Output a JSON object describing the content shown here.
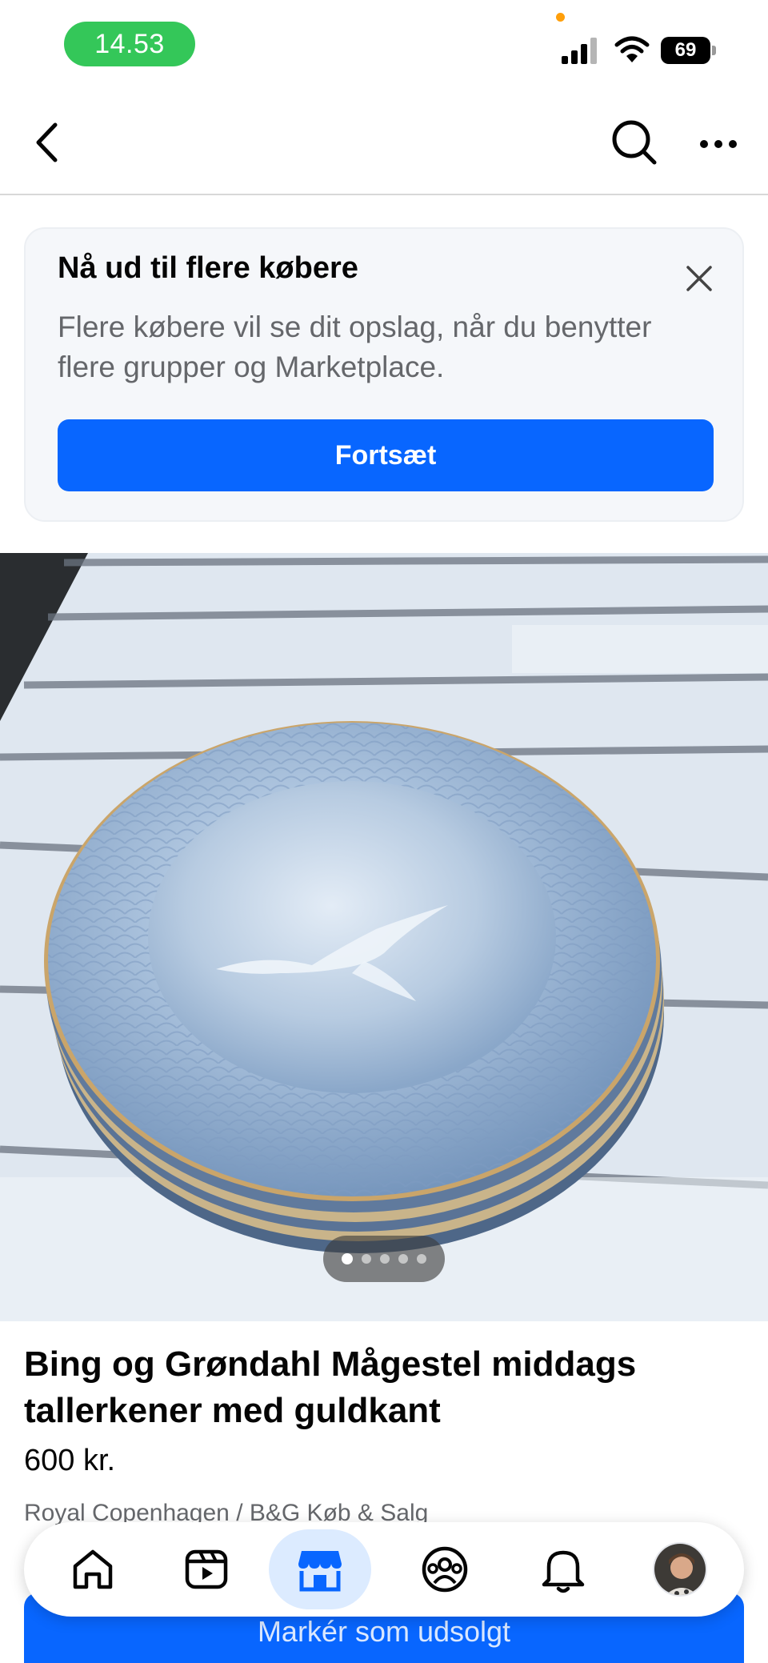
{
  "status_bar": {
    "time": "14.53",
    "battery": "69"
  },
  "nav": {
    "back_icon": "chevron-left-icon",
    "search_icon": "search-icon",
    "more_icon": "more-horizontal-icon"
  },
  "promo": {
    "title": "Nå ud til flere købere",
    "text": "Flere købere vil se dit opslag, når du benytter flere grupper og Marketplace.",
    "button_label": "Fortsæt",
    "close_icon": "close-icon"
  },
  "photo": {
    "dot_count": 5,
    "active_dot": 0
  },
  "listing": {
    "title": "Bing og Grøndahl Mågestel middags tallerkener med guldkant",
    "price": "600 kr.",
    "group": "Royal Copenhagen / B&G Køb & Salg",
    "sold_button_label": "Markér som udsolgt"
  },
  "tab_bar": {
    "items": [
      {
        "name": "home",
        "icon": "home-icon"
      },
      {
        "name": "video",
        "icon": "video-icon"
      },
      {
        "name": "marketplace",
        "icon": "marketplace-icon",
        "active": true
      },
      {
        "name": "groups",
        "icon": "groups-icon"
      },
      {
        "name": "notifications",
        "icon": "bell-icon"
      },
      {
        "name": "profile",
        "icon": "avatar"
      }
    ]
  },
  "colors": {
    "accent": "#0866ff",
    "status_green": "#34c759",
    "active_tab_bg": "#dcebff",
    "secondary_text": "#65676b"
  }
}
